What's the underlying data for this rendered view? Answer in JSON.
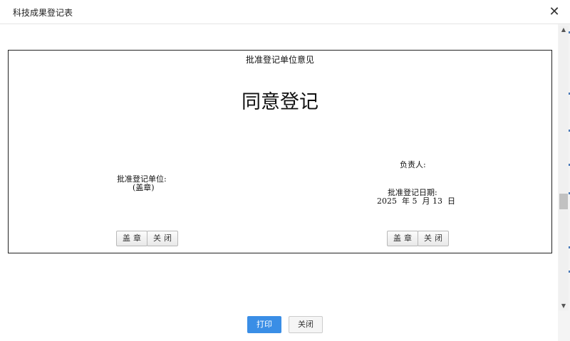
{
  "dialog": {
    "title": "科技成果登记表",
    "close_glyph": "✕"
  },
  "form": {
    "heading": "批准登记单位意见",
    "opinion": "同意登记",
    "unit_label": "批准登记单位:",
    "seal_note": "(盖章)",
    "responsible_label": "负责人:",
    "date_label": "批准登记日期:",
    "date_value": "2025  年 5  月 13  日",
    "left_buttons": {
      "seal": "盖章",
      "close": "关闭"
    },
    "right_buttons": {
      "seal": "盖章",
      "close": "关闭"
    }
  },
  "footer": {
    "print_label": "打印",
    "close_label": "关闭"
  },
  "scrollbar": {
    "up_glyph": "▲",
    "down_glyph": "▼"
  },
  "colors": {
    "primary": "#3a8ee6",
    "border": "#222222"
  }
}
